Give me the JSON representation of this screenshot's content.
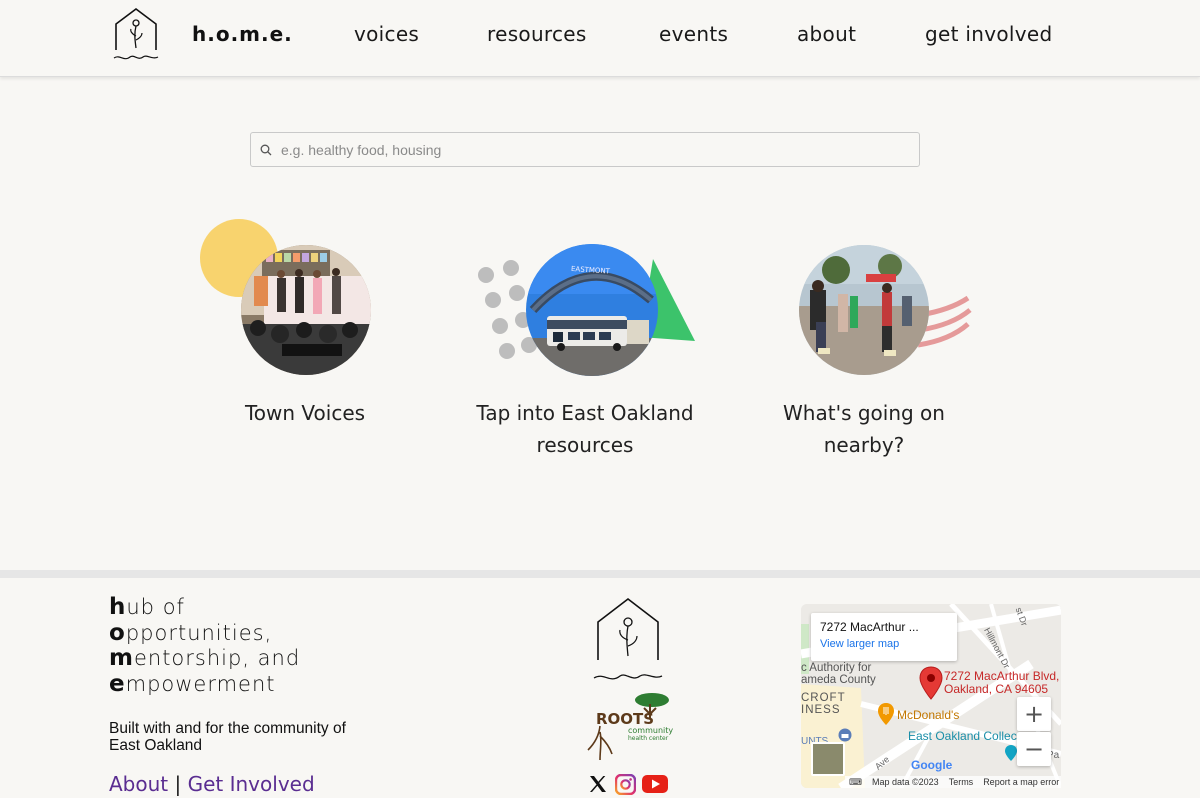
{
  "header": {
    "home_label": "h.o.m.e.",
    "nav": [
      {
        "label": "voices"
      },
      {
        "label": "resources"
      },
      {
        "label": "events"
      },
      {
        "label": "about"
      },
      {
        "label": "get involved"
      }
    ]
  },
  "search": {
    "placeholder": "e.g. healthy food, housing",
    "value": ""
  },
  "tiles": [
    {
      "label": "Town Voices",
      "icon": "town-voices-photo",
      "accent": "#f8d36e"
    },
    {
      "label_line1": "Tap into East Oakland",
      "label_line2": "resources",
      "icon": "eastmont-bus-photo",
      "accent": "#3cc36b",
      "sign_text": "EASTMONT"
    },
    {
      "label_line1": "What's going on",
      "label_line2": "nearby?",
      "icon": "roller-skating-photo",
      "accent": "#e59a9a"
    }
  ],
  "footer": {
    "acronym": [
      {
        "initial": "h",
        "rest": "ub of"
      },
      {
        "initial": "o",
        "rest": "pportunities,"
      },
      {
        "initial": "m",
        "rest": "entorship, and"
      },
      {
        "initial": "e",
        "rest": "mpowerment"
      }
    ],
    "tagline": "Built with and for the community of East Oakland",
    "links": {
      "about": "About",
      "separator": "|",
      "get_involved": "Get Involved"
    },
    "logo_text": "home",
    "partner": {
      "name": "ROOTS",
      "line2": "community",
      "line3": "health center"
    },
    "social": [
      "x-icon",
      "instagram-icon",
      "youtube-icon"
    ],
    "colors": {
      "link": "#5a2d91",
      "background": "#f8f7f4"
    }
  },
  "map": {
    "address_short": "7272 MacArthur ...",
    "view_larger": "View larger map",
    "pin_line1": "7272 MacArthur Blvd,",
    "pin_line2": "Oakland, CA 94605",
    "labels": {
      "authority": "c Authority for",
      "county": "ameda County",
      "croft": "CROFT",
      "iness": "INESS",
      "mcdonalds": "McDonald's",
      "collect": "East Oakland Collect",
      "unts": "UNTS",
      "hillmont": "Hillmont Dr",
      "ave": "Ave",
      "st": "st Dr",
      "pa": "Pa",
      "google": "Google"
    },
    "footer": {
      "data": "Map data ©2023",
      "terms": "Terms",
      "report": "Report a map error"
    },
    "zoom_in": "+",
    "zoom_out": "−"
  }
}
